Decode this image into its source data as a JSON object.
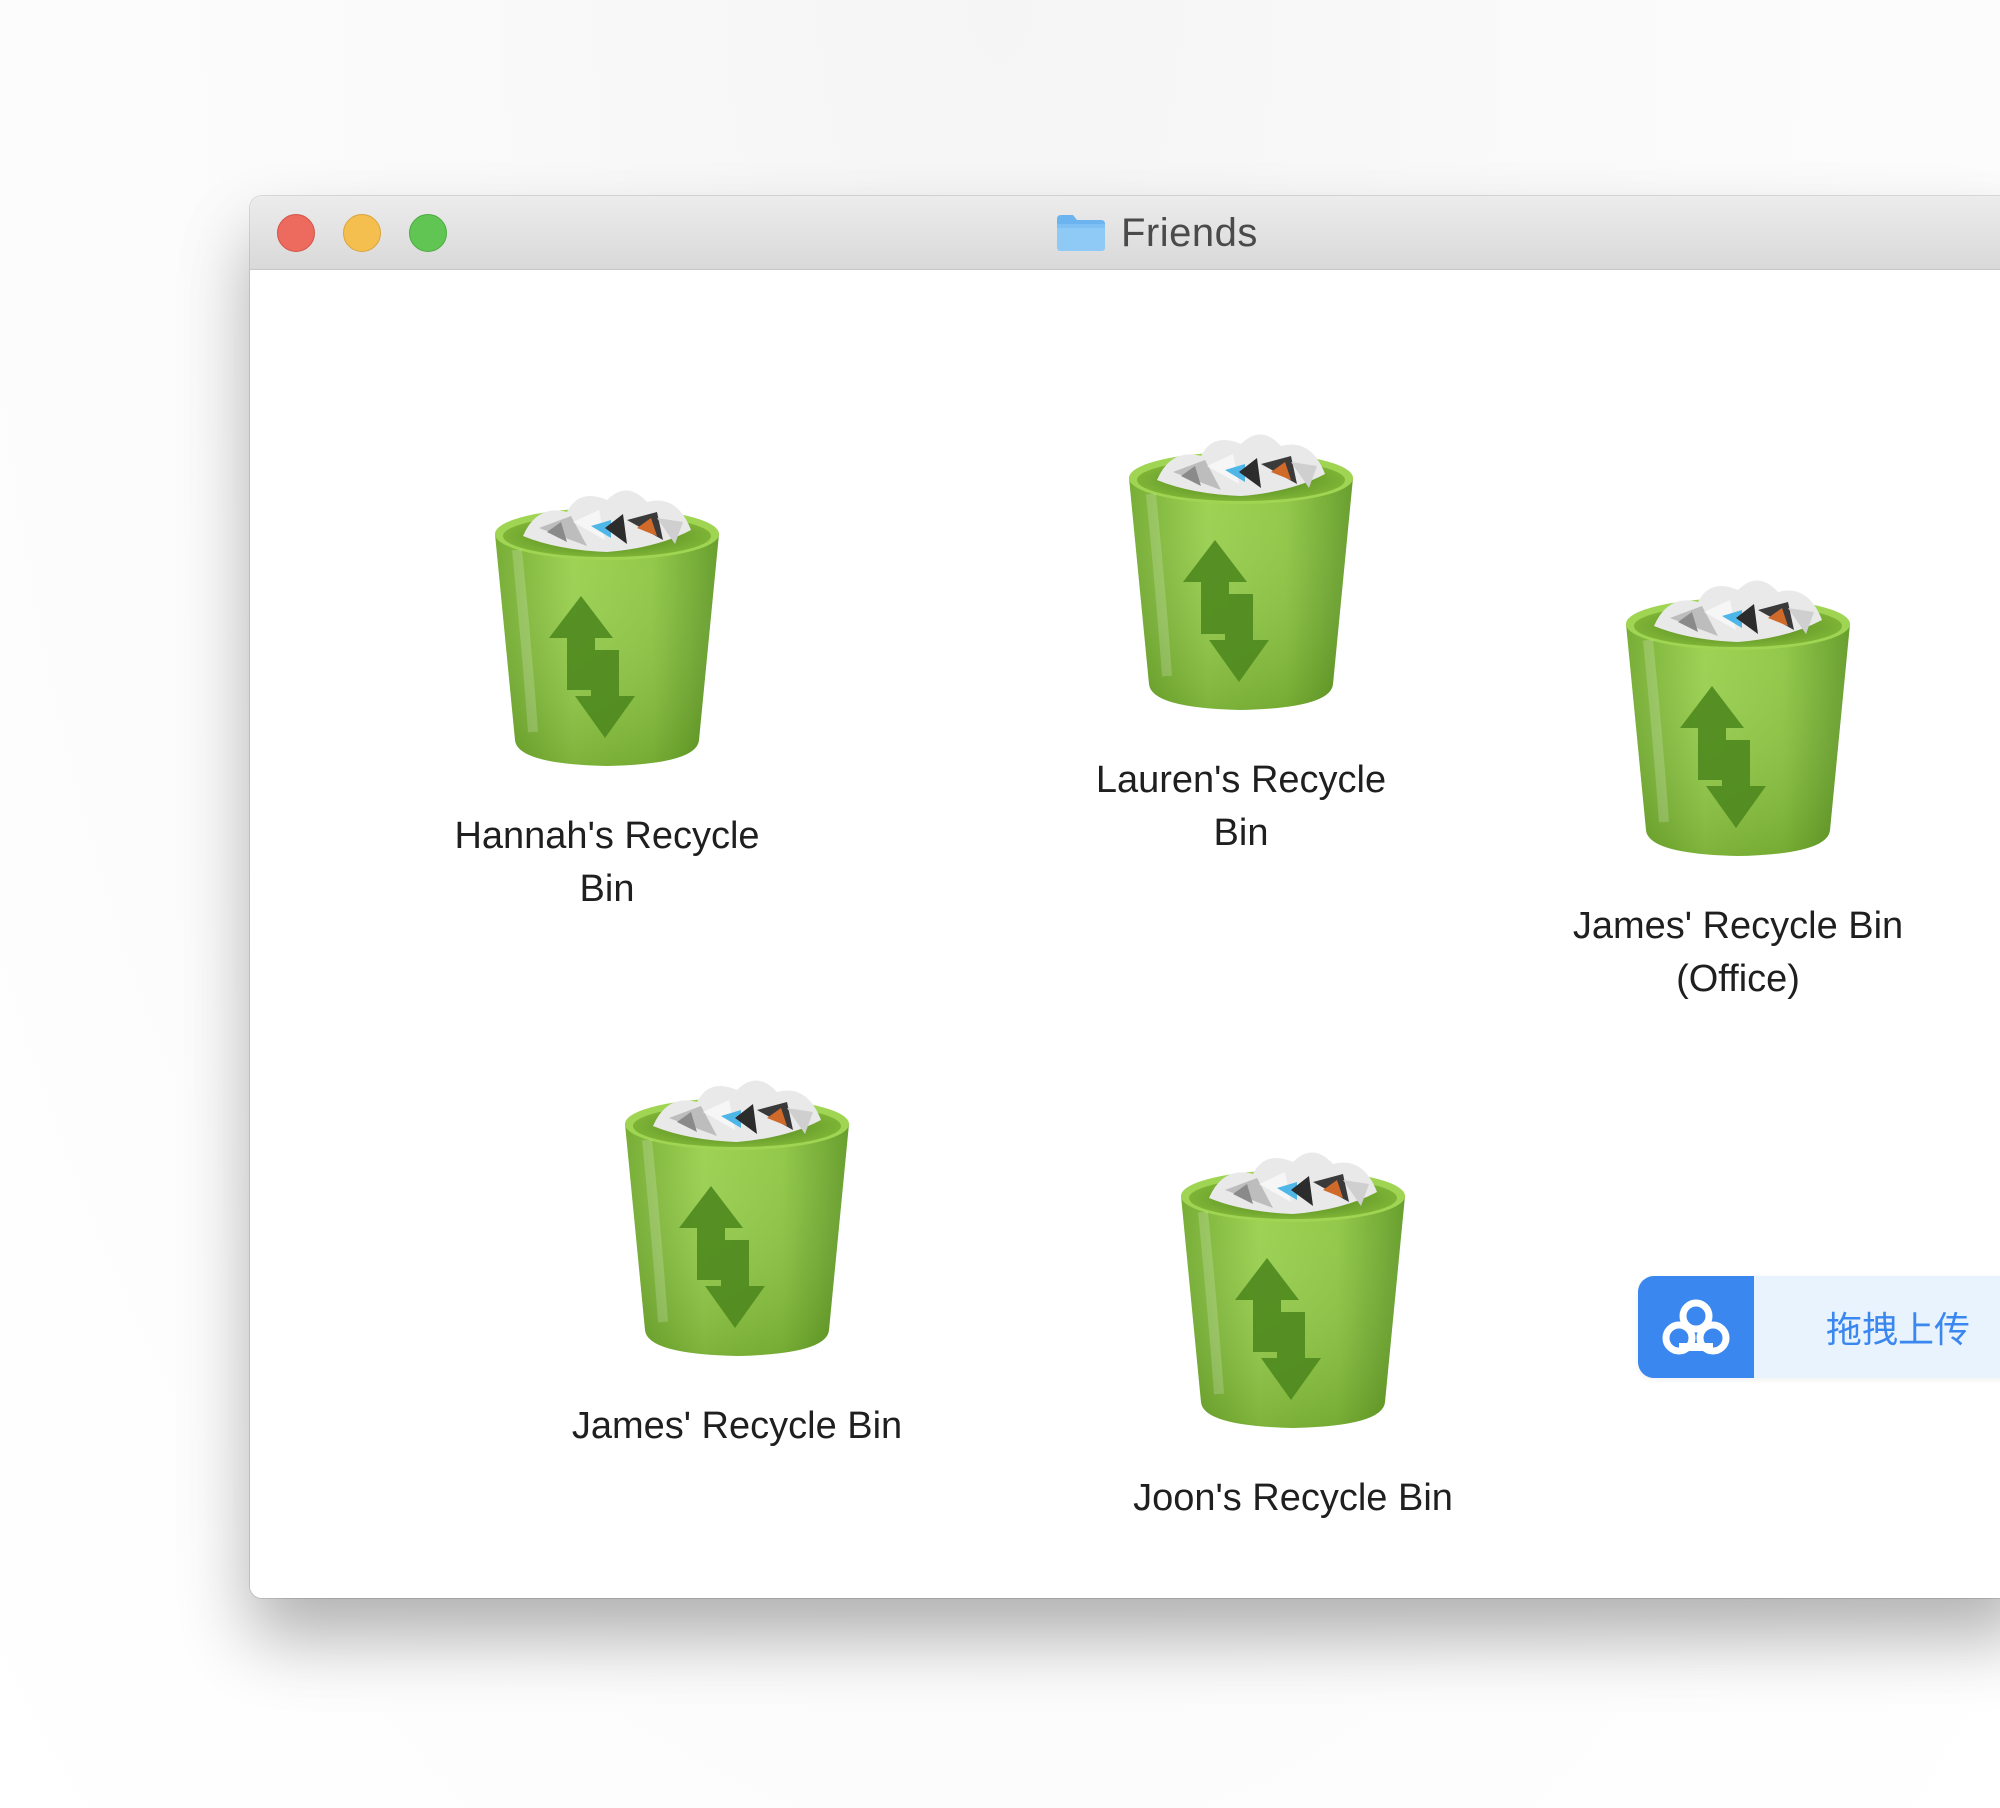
{
  "window": {
    "title": "Friends"
  },
  "items": [
    {
      "label": "Hannah's Recycle\nBin"
    },
    {
      "label": "Lauren's Recycle\nBin"
    },
    {
      "label": "James' Recycle Bin\n(Office)"
    },
    {
      "label": "James' Recycle Bin"
    },
    {
      "label": "Joon's Recycle Bin"
    }
  ],
  "upload_widget": {
    "label": "拖拽上传"
  },
  "icons": {
    "window_title": "folder-icon",
    "items": "recycle-bin-icon",
    "upload": "cloud-icon"
  },
  "colors": {
    "bin_green": "#8cc63f",
    "arrow_green": "#4f8a1f",
    "upload_blue": "#3a87f0"
  }
}
